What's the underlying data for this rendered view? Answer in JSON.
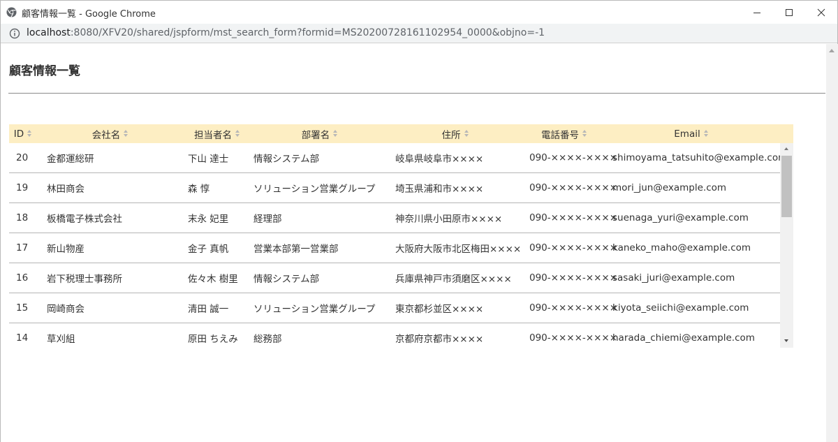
{
  "window": {
    "title": "顧客情報一覧 - Google Chrome",
    "url_host": "localhost",
    "url_path": ":8080/XFV20/shared/jspform/mst_search_form?formid=MS20200728161102954_0000&objno=-1"
  },
  "page": {
    "title": "顧客情報一覧"
  },
  "table": {
    "headers": {
      "id": "ID",
      "company": "会社名",
      "contact": "担当者名",
      "department": "部署名",
      "address": "住所",
      "phone": "電話番号",
      "email": "Email"
    },
    "rows": [
      {
        "id": "20",
        "company": "金都運総研",
        "contact": "下山 達士",
        "department": "情報システム部",
        "address": "岐阜県岐阜市××××",
        "phone": "090-××××-××××",
        "email": "shimoyama_tatsuhito@example.com"
      },
      {
        "id": "19",
        "company": "林田商会",
        "contact": "森 惇",
        "department": "ソリューション営業グループ",
        "address": "埼玉県浦和市××××",
        "phone": "090-××××-××××",
        "email": "mori_jun@example.com"
      },
      {
        "id": "18",
        "company": "板橋電子株式会社",
        "contact": "末永 妃里",
        "department": "経理部",
        "address": "神奈川県小田原市××××",
        "phone": "090-××××-××××",
        "email": "suenaga_yuri@example.com"
      },
      {
        "id": "17",
        "company": "新山物産",
        "contact": "金子 真帆",
        "department": "営業本部第一営業部",
        "address": "大阪府大阪市北区梅田××××",
        "phone": "090-××××-××××",
        "email": "kaneko_maho@example.com"
      },
      {
        "id": "16",
        "company": "岩下税理士事務所",
        "contact": "佐々木 樹里",
        "department": "情報システム部",
        "address": "兵庫県神戸市須磨区××××",
        "phone": "090-××××-××××",
        "email": "sasaki_juri@example.com"
      },
      {
        "id": "15",
        "company": "岡崎商会",
        "contact": "清田 誠一",
        "department": "ソリューション営業グループ",
        "address": "東京都杉並区××××",
        "phone": "090-××××-××××",
        "email": "kiyota_seiichi@example.com"
      },
      {
        "id": "14",
        "company": "草刈組",
        "contact": "原田 ちえみ",
        "department": "総務部",
        "address": "京都府京都市××××",
        "phone": "090-××××-××××",
        "email": "harada_chiemi@example.com"
      }
    ]
  }
}
